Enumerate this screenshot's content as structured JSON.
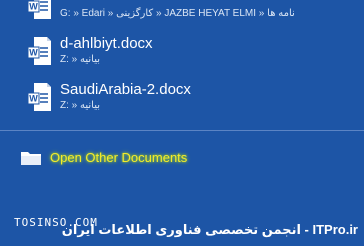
{
  "recent_documents": [
    {
      "name": "",
      "path": "G: » Edari » کارگزینی » JAZBE  HEYAT ELMI » نامه ها"
    },
    {
      "name": "d-ahlbiyt.docx",
      "path": "Z: » بیانیه"
    },
    {
      "name": "SaudiArabia-2.docx",
      "path": "Z: » بیانیه"
    }
  ],
  "open_other": {
    "label": "Open Other Documents"
  },
  "footer": {
    "left_text": "TOSINSO.COM",
    "right_text": "ITPro.ir - انجمن تخصصی فناوری اطلاعات ایران"
  },
  "colors": {
    "background": "#1d55a6",
    "highlight_text": "#f5ec2a",
    "highlight_glow": "#98c92e"
  },
  "icons": {
    "document": "word-document-icon",
    "folder": "folder-icon"
  }
}
